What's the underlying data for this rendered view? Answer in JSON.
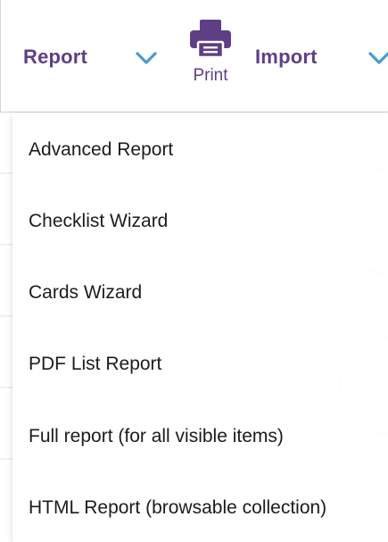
{
  "toolbar": {
    "report_label": "Report",
    "print_label": "Print",
    "import_label": "Import"
  },
  "icons": {
    "report_dropdown": "chevron-down-icon",
    "import_dropdown": "chevron-down-icon",
    "print": "printer-icon"
  },
  "colors": {
    "accent": "#5e3f86",
    "chevron": "#4a9bd1",
    "menu_text": "#1c1c1c"
  },
  "report_menu": {
    "items": [
      {
        "label": "Advanced Report"
      },
      {
        "label": "Checklist Wizard"
      },
      {
        "label": "Cards Wizard"
      },
      {
        "label": "PDF List Report"
      },
      {
        "label": "Full report (for all visible items)"
      },
      {
        "label": "HTML Report (browsable collection)"
      }
    ]
  }
}
